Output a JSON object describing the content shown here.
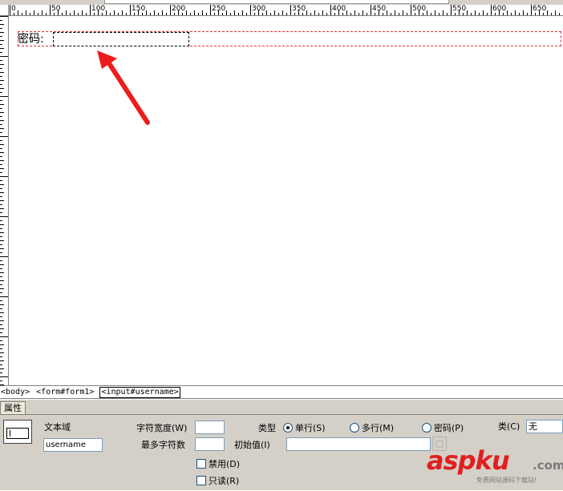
{
  "ruler": {
    "labels": [
      "0",
      "50",
      "100",
      "150",
      "200",
      "250",
      "300",
      "350",
      "400",
      "450",
      "500",
      "550",
      "600",
      "650"
    ]
  },
  "design": {
    "password_label": "密码:"
  },
  "tag_selector": {
    "tags": [
      "<body>",
      "<form#form1>",
      "<input#username>"
    ]
  },
  "properties": {
    "tab_label": "属性",
    "element_type": "文本域",
    "element_name": "username",
    "char_width_label": "字符宽度(W)",
    "char_width_value": "",
    "max_chars_label": "最多字符数",
    "max_chars_value": "",
    "type_label": "类型",
    "type_single": "单行(S)",
    "type_multi": "多行(M)",
    "type_password": "密码(P)",
    "initial_value_label": "初始值(I)",
    "initial_value": "",
    "disabled_label": "禁用(D)",
    "readonly_label": "只读(R)",
    "class_label": "类(C)",
    "class_value": "无",
    "selected_type": "单行(S)"
  },
  "watermark": {
    "brand": "aspku",
    "tld": ".com",
    "tagline": "免费网站源码下载站!"
  },
  "colors": {
    "arrow": "#ee1c1c",
    "form_outline": "#e0323c",
    "panel": "#d4d0c8"
  }
}
